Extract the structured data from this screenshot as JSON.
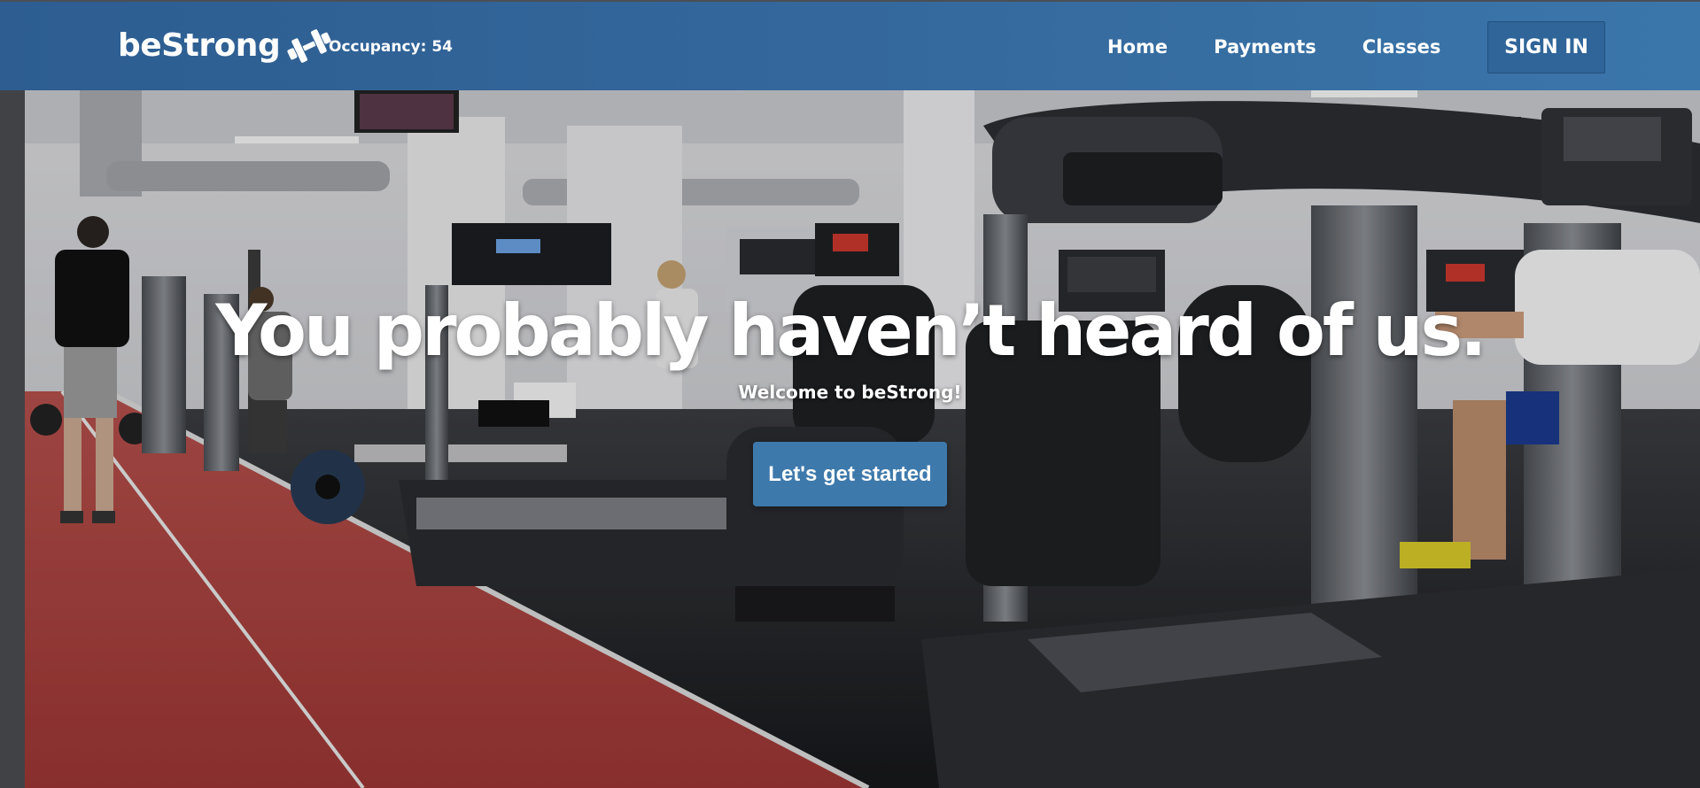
{
  "header": {
    "brand": "beStrong",
    "brand_icon": "dumbbell-icon",
    "occupancy_label": "Occupancy: 54",
    "nav": [
      {
        "label": "Home"
      },
      {
        "label": "Payments"
      },
      {
        "label": "Classes"
      }
    ],
    "signin_label": "SIGN IN"
  },
  "hero": {
    "title": "You probably haven’t heard of us.",
    "subtitle": "Welcome to beStrong!",
    "cta_label": "Let's get started",
    "background": "gym-floor-photo"
  },
  "colors": {
    "navbar": "#34689c",
    "accent": "#3e79ab",
    "track": "#a9413f"
  }
}
